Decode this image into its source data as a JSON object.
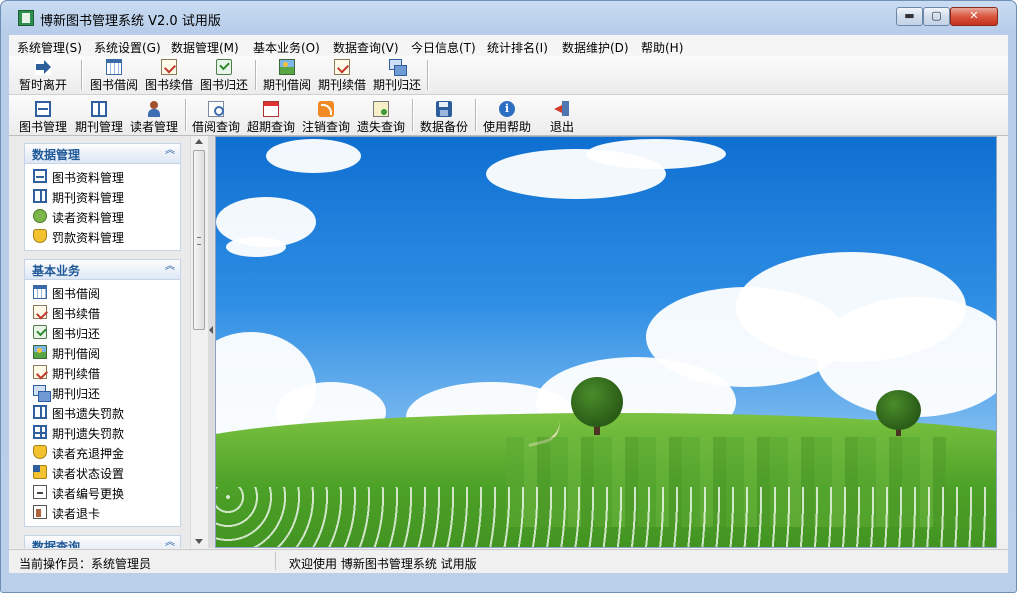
{
  "window": {
    "title": "博新图书管理系统 V2.0  试用版",
    "min_label": "▬",
    "max_label": "▢",
    "close_label": "✕"
  },
  "menu": [
    "系统管理(S)",
    "系统设置(G)",
    "数据管理(M)",
    "基本业务(O)",
    "数据查询(V)",
    "今日信息(T)",
    "统计排名(I)",
    "数据维护(D)",
    "帮助(H)"
  ],
  "toolbar1": [
    "暂时离开",
    "图书借阅",
    "图书续借",
    "图书归还",
    "期刊借阅",
    "期刊续借",
    "期刊归还"
  ],
  "toolbar2": [
    "图书管理",
    "期刊管理",
    "读者管理",
    "借阅查询",
    "超期查询",
    "注销查询",
    "遗失查询",
    "数据备份",
    "使用帮助",
    "退出"
  ],
  "panel": {
    "groups": [
      {
        "title": "数据管理",
        "toggle": "︽",
        "items": [
          "图书资料管理",
          "期刊资料管理",
          "读者资料管理",
          "罚款资料管理"
        ]
      },
      {
        "title": "基本业务",
        "toggle": "︽",
        "items": [
          "图书借阅",
          "图书续借",
          "图书归还",
          "期刊借阅",
          "期刊续借",
          "期刊归还",
          "图书遗失罚款",
          "期刊遗失罚款",
          "读者充退押金",
          "读者状态设置",
          "读者编号更换",
          "读者退卡"
        ]
      },
      {
        "title": "数据查询",
        "toggle": "︽",
        "items": []
      }
    ]
  },
  "status": {
    "operator": "当前操作员：系统管理员",
    "welcome": "欢迎使用  博新图书管理系统  试用版"
  },
  "colors": {
    "accent": "#215a99",
    "sky": "#2e8ee4",
    "grass": "#4da228"
  }
}
